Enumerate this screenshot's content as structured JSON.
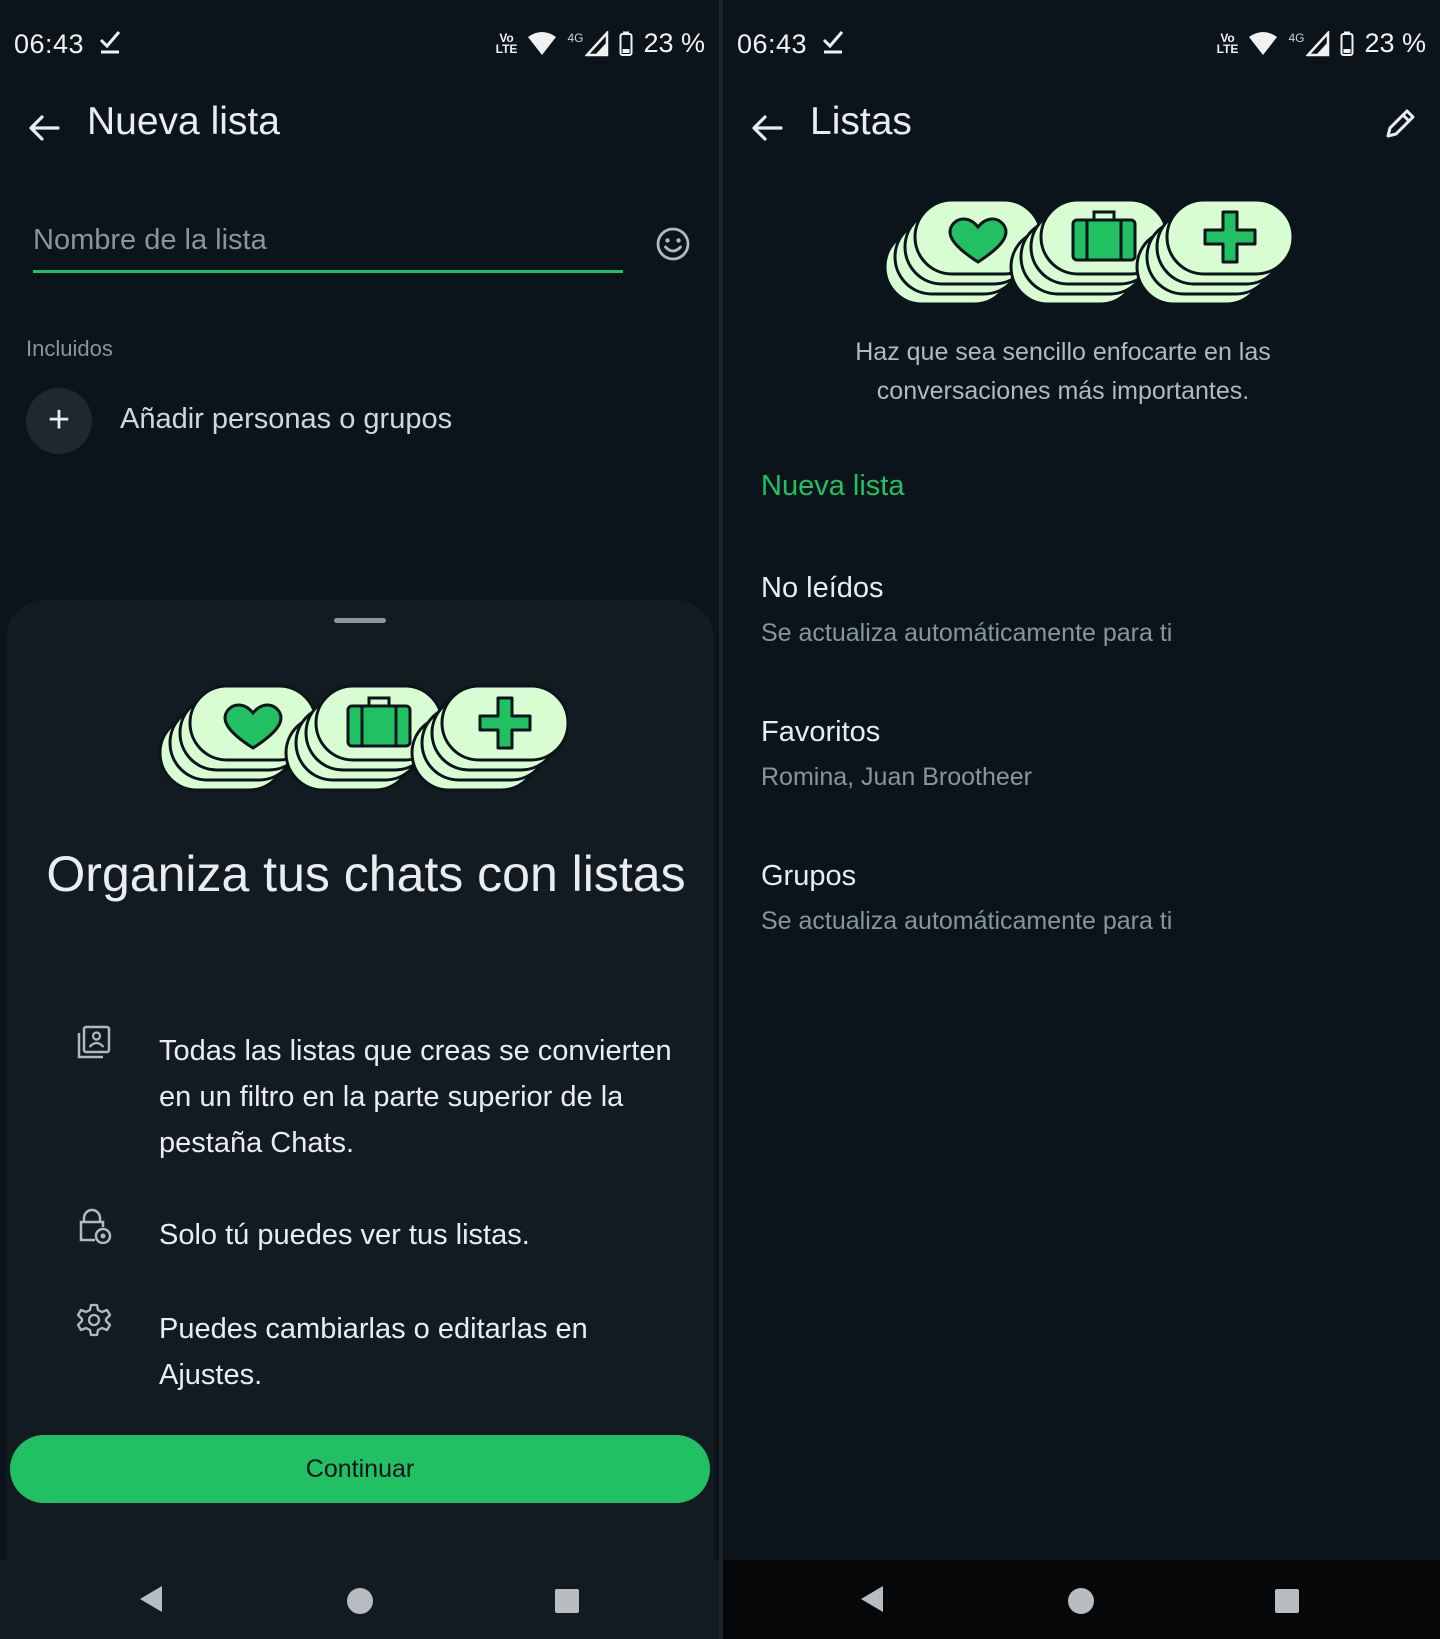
{
  "colors": {
    "accent": "#21c063",
    "background": "#0b141a",
    "sheet": "#121b22",
    "illustration_fill": "#d9fdd3",
    "text_primary": "#e9edef",
    "text_secondary": "#8696a0"
  },
  "left": {
    "status": {
      "time": "06:43",
      "battery": "23 %",
      "volte": "VoLTE",
      "network": "4G"
    },
    "header": {
      "title": "Nueva lista",
      "back_icon": "arrow-left-icon"
    },
    "name_field": {
      "placeholder": "Nombre de la lista",
      "value": "",
      "emoji_icon": "smiley-icon"
    },
    "included": {
      "label": "Incluidos",
      "add_label": "Añadir personas o grupos",
      "add_icon_glyph": "+"
    },
    "sheet": {
      "illustration_icons": [
        "heart-icon",
        "briefcase-icon",
        "plus-icon"
      ],
      "title": "Organiza tus chats con listas",
      "features": [
        {
          "icon": "filter-list-icon",
          "text": "Todas las listas que creas se convierten en un filtro en la parte superior de la pestaña Chats."
        },
        {
          "icon": "lock-icon",
          "text": "Solo tú puedes ver tus listas."
        },
        {
          "icon": "gear-icon",
          "text": "Puedes cambiarlas o editarlas en Ajustes."
        }
      ],
      "continue_label": "Continuar"
    }
  },
  "right": {
    "status": {
      "time": "06:43",
      "battery": "23 %",
      "volte": "VoLTE",
      "network": "4G"
    },
    "header": {
      "title": "Listas",
      "back_icon": "arrow-left-icon",
      "edit_icon": "pencil-icon"
    },
    "illustration_icons": [
      "heart-icon",
      "briefcase-icon",
      "plus-icon"
    ],
    "description": "Haz que sea sencillo enfocarte en las conversaciones más importantes.",
    "new_list_label": "Nueva lista",
    "lists": [
      {
        "title": "No leídos",
        "subtitle": "Se actualiza automáticamente para ti"
      },
      {
        "title": "Favoritos",
        "subtitle": "Romina, Juan Brootheer"
      },
      {
        "title": "Grupos",
        "subtitle": "Se actualiza automáticamente para ti"
      }
    ]
  }
}
